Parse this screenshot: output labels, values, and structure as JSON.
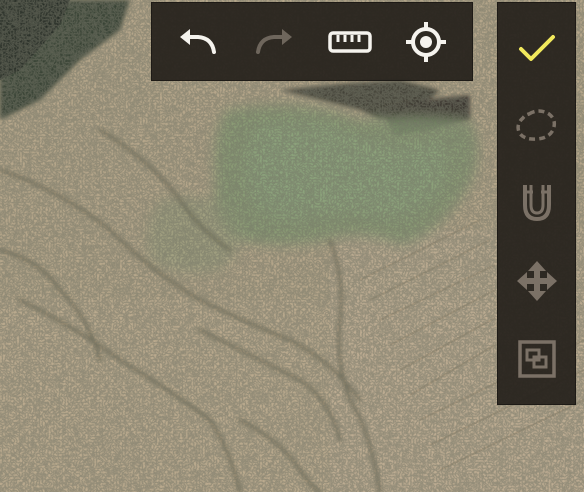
{
  "map": {
    "type": "satellite-imagery"
  },
  "top_toolbar": {
    "tools": [
      {
        "name": "undo",
        "icon": "undo-arrow-icon",
        "state": "enabled"
      },
      {
        "name": "redo",
        "icon": "redo-arrow-icon",
        "state": "disabled"
      },
      {
        "name": "measure",
        "icon": "ruler-icon",
        "state": "enabled"
      },
      {
        "name": "locate",
        "icon": "crosshair-target-icon",
        "state": "enabled"
      }
    ]
  },
  "side_toolbar": {
    "tools": [
      {
        "name": "confirm",
        "icon": "checkmark-icon",
        "state": "active"
      },
      {
        "name": "lasso-select",
        "icon": "dashed-lasso-icon",
        "state": "inactive"
      },
      {
        "name": "snap",
        "icon": "magnet-icon",
        "state": "inactive"
      },
      {
        "name": "move",
        "icon": "move-arrows-icon",
        "state": "inactive"
      },
      {
        "name": "group",
        "icon": "group-squares-icon",
        "state": "inactive"
      }
    ]
  },
  "colors": {
    "toolbar_bg": "#26211c",
    "icon_active": "#f5f3ee",
    "icon_disabled": "#6e665c",
    "icon_inactive": "#7b7166",
    "accent": "#f1e95c"
  }
}
